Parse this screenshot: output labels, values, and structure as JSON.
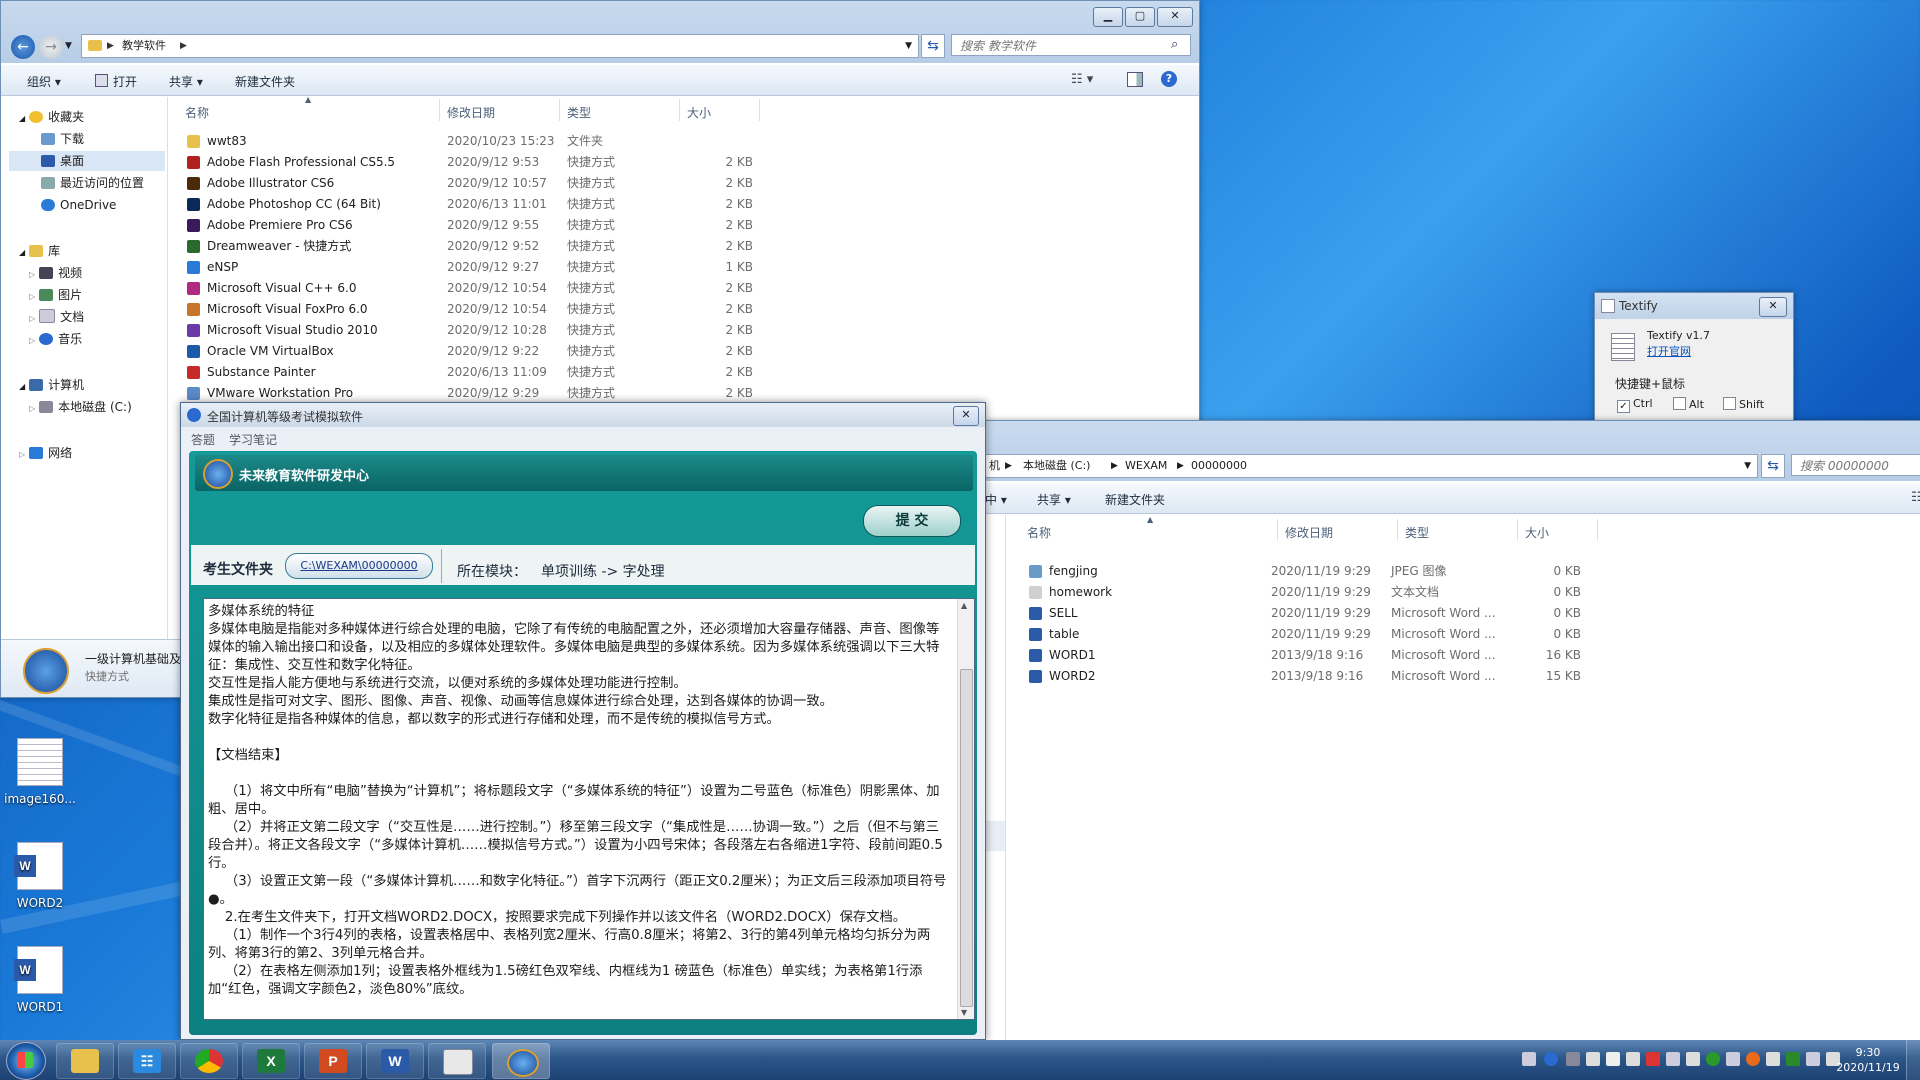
{
  "explorer1": {
    "path": [
      "教学软件"
    ],
    "search_placeholder": "搜索 教学软件",
    "toolbar": {
      "organize": "组织 ▾",
      "open": "打开",
      "share": "共享 ▾",
      "new_folder": "新建文件夹"
    },
    "nav": {
      "favorites": "收藏夹",
      "downloads": "下载",
      "desktop": "桌面",
      "recent": "最近访问的位置",
      "onedrive": "OneDrive",
      "libraries": "库",
      "videos": "视频",
      "pictures": "图片",
      "documents": "文档",
      "music": "音乐",
      "computer": "计算机",
      "local_disk": "本地磁盘 (C:)",
      "network": "网络"
    },
    "columns": {
      "name": "名称",
      "date": "修改日期",
      "type": "类型",
      "size": "大小"
    },
    "files": [
      {
        "name": "wwt83",
        "date": "2020/10/23 15:23",
        "type": "文件夹",
        "size": "",
        "color": "#e8c04c"
      },
      {
        "name": "Adobe Flash Professional CS5.5",
        "date": "2020/9/12 9:53",
        "type": "快捷方式",
        "size": "2 KB",
        "color": "#b32020"
      },
      {
        "name": "Adobe Illustrator CS6",
        "date": "2020/9/12 10:57",
        "type": "快捷方式",
        "size": "2 KB",
        "color": "#4a2a0a"
      },
      {
        "name": "Adobe Photoshop CC (64 Bit)",
        "date": "2020/6/13 11:01",
        "type": "快捷方式",
        "size": "2 KB",
        "color": "#0a2a5a"
      },
      {
        "name": "Adobe Premiere Pro CS6",
        "date": "2020/9/12 9:55",
        "type": "快捷方式",
        "size": "2 KB",
        "color": "#3a1a5a"
      },
      {
        "name": "Dreamweaver - 快捷方式",
        "date": "2020/9/12 9:52",
        "type": "快捷方式",
        "size": "2 KB",
        "color": "#2a6a2a"
      },
      {
        "name": "eNSP",
        "date": "2020/9/12 9:27",
        "type": "快捷方式",
        "size": "1 KB",
        "color": "#2a7ad8"
      },
      {
        "name": "Microsoft Visual C++ 6.0",
        "date": "2020/9/12 10:54",
        "type": "快捷方式",
        "size": "2 KB",
        "color": "#b02a80"
      },
      {
        "name": "Microsoft Visual FoxPro 6.0",
        "date": "2020/9/12 10:54",
        "type": "快捷方式",
        "size": "2 KB",
        "color": "#c8742a"
      },
      {
        "name": "Microsoft Visual Studio 2010",
        "date": "2020/9/12 10:28",
        "type": "快捷方式",
        "size": "2 KB",
        "color": "#6a3aa8"
      },
      {
        "name": "Oracle VM VirtualBox",
        "date": "2020/9/12 9:22",
        "type": "快捷方式",
        "size": "2 KB",
        "color": "#1a5aa8"
      },
      {
        "name": "Substance Painter",
        "date": "2020/6/13 11:09",
        "type": "快捷方式",
        "size": "2 KB",
        "color": "#c82a2a"
      },
      {
        "name": "VMware Workstation Pro",
        "date": "2020/9/12 9:29",
        "type": "快捷方式",
        "size": "2 KB",
        "color": "#5a8ac8"
      }
    ],
    "details": {
      "name": "一级计算机基础及",
      "type": "快捷方式"
    }
  },
  "explorer2": {
    "path": [
      "机",
      "本地磁盘 (C:)",
      "WEXAM",
      "00000000"
    ],
    "search_placeholder": "搜索 00000000",
    "toolbar": {
      "partial": "中 ▾",
      "share": "共享 ▾",
      "new_folder": "新建文件夹"
    },
    "columns": {
      "name": "名称",
      "date": "修改日期",
      "type": "类型",
      "size": "大小"
    },
    "files": [
      {
        "name": "fengjing",
        "date": "2020/11/19 9:29",
        "type": "JPEG 图像",
        "size": "0 KB",
        "color": "#6a9ac8"
      },
      {
        "name": "homework",
        "date": "2020/11/19 9:29",
        "type": "文本文档",
        "size": "0 KB",
        "color": "#d0d0d0"
      },
      {
        "name": "SELL",
        "date": "2020/11/19 9:29",
        "type": "Microsoft Word ...",
        "size": "0 KB",
        "color": "#2a5aa8"
      },
      {
        "name": "table",
        "date": "2020/11/19 9:29",
        "type": "Microsoft Word ...",
        "size": "0 KB",
        "color": "#2a5aa8"
      },
      {
        "name": "WORD1",
        "date": "2013/9/18 9:16",
        "type": "Microsoft Word ...",
        "size": "16 KB",
        "color": "#2a5aa8"
      },
      {
        "name": "WORD2",
        "date": "2013/9/18 9:16",
        "type": "Microsoft Word ...",
        "size": "15 KB",
        "color": "#2a5aa8"
      }
    ]
  },
  "textify": {
    "title": "Textify",
    "version": "Textify v1.7",
    "link": "打开官网",
    "group": "快捷键+鼠标",
    "ctrl": "Ctrl",
    "alt": "Alt",
    "shift": "Shift"
  },
  "exam": {
    "title": "全国计算机等级考试模拟软件",
    "menu": {
      "answer": "答题",
      "notes": "学习笔记"
    },
    "banner": "未来教育软件研发中心",
    "submit": "提 交",
    "folder_label": "考生文件夹",
    "folder_path": "C:\\WEXAM\\00000000",
    "module_label": "所在模块：",
    "module_value": "单项训练 -> 字处理",
    "doc_lines": [
      "多媒体系统的特征",
      "多媒体电脑是指能对多种媒体进行综合处理的电脑，它除了有传统的电脑配置之外，还必须增加大容量存储器、声音、图像等媒体的输入输出接口和设备，以及相应的多媒体处理软件。多媒体电脑是典型的多媒体系统。因为多媒体系统强调以下三大特征：集成性、交互性和数字化特征。",
      "交互性是指人能方便地与系统进行交流，以便对系统的多媒体处理功能进行控制。",
      "集成性是指可对文字、图形、图像、声音、视像、动画等信息媒体进行综合处理，达到各媒体的协调一致。",
      "数字化特征是指各种媒体的信息，都以数字的形式进行存储和处理，而不是传统的模拟信号方式。",
      "",
      "【文档结束】",
      "",
      "    （1）将文中所有“电脑”替换为“计算机”；将标题段文字（“多媒体系统的特征”）设置为二号蓝色（标准色）阴影黑体、加粗、居中。",
      "    （2）并将正文第二段文字（“交互性是……进行控制。”）移至第三段文字（“集成性是……协调一致。”）之后（但不与第三段合并）。将正文各段文字（“多媒体计算机……模拟信号方式。”）设置为小四号宋体；各段落左右各缩进1字符、段前间距0.5行。",
      "    （3）设置正文第一段（“多媒体计算机……和数字化特征。”）首字下沉两行（距正文0.2厘米）；为正文后三段添加项目符号●。",
      "    2.在考生文件夹下，打开文档WORD2.DOCX，按照要求完成下列操作并以该文件名（WORD2.DOCX）保存文档。",
      "    （1）制作一个3行4列的表格，设置表格居中、表格列宽2厘米、行高0.8厘米；将第2、3行的第4列单元格均匀拆分为两列、将第3行的第2、3列单元格合并。",
      "    （2）在表格左侧添加1列；设置表格外框线为1.5磅红色双窄线、内框线为1 磅蓝色（标准色）单实线；为表格第1行添加“红色，强调文字颜色2，淡色80%”底纹。"
    ]
  },
  "desktop_icons": [
    {
      "label": "image160..."
    },
    {
      "label": "WORD2"
    },
    {
      "label": "WORD1"
    }
  ],
  "taskbar": {
    "time": "9:30",
    "date": "2020/11/19"
  }
}
